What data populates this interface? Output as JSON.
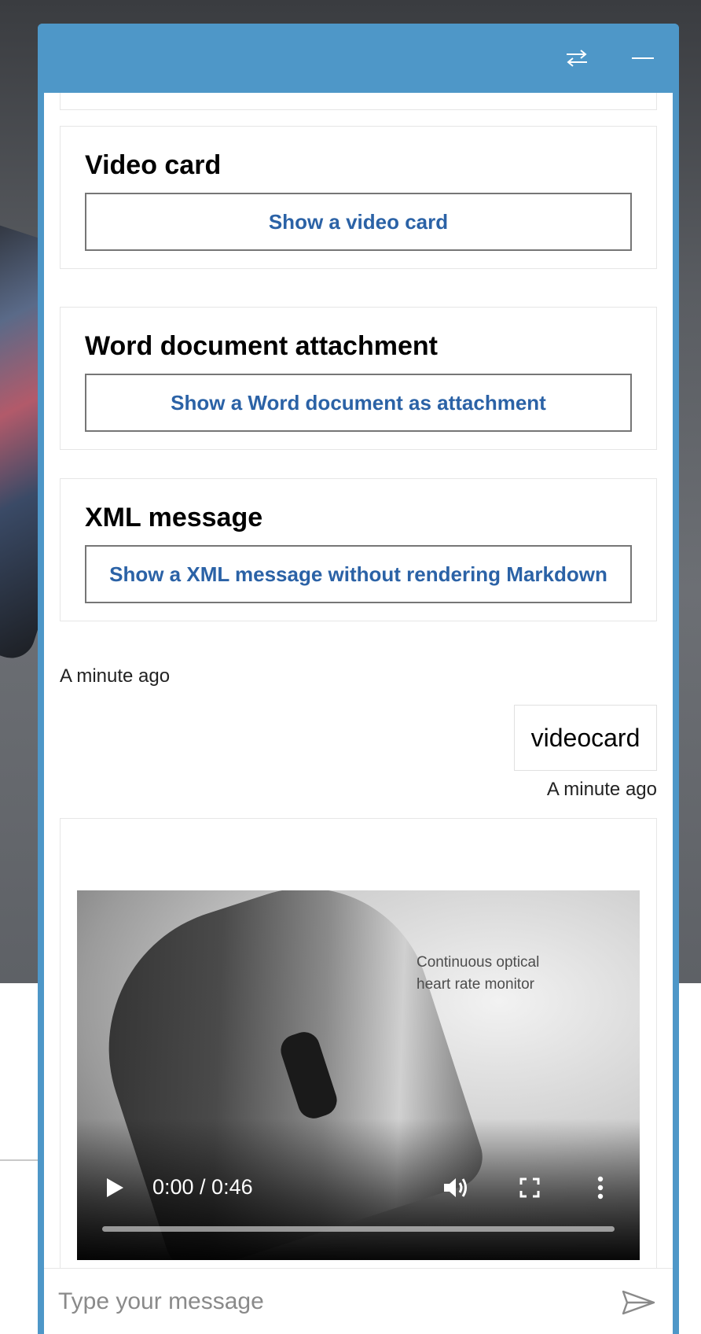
{
  "cards": [
    {
      "title": "Video card",
      "action": "Show a video card"
    },
    {
      "title": "Word document attachment",
      "action": "Show a Word document as attachment"
    },
    {
      "title": "XML message",
      "action": "Show a XML message without rendering Markdown"
    }
  ],
  "bot_timestamp": "A minute ago",
  "user_message": {
    "text": "videocard",
    "timestamp": "A minute ago"
  },
  "video": {
    "caption_line1": "Continuous optical",
    "caption_line2": "heart rate monitor",
    "time": "0:00 / 0:46",
    "progress": 0.0
  },
  "send_box": {
    "placeholder": "Type your message"
  },
  "colors": {
    "header": "#4e97c8",
    "action_text": "#2b62a6"
  },
  "icons": {
    "header_left": "switch-arrows-icon",
    "header_right": "minimize-icon",
    "send": "send-icon",
    "play": "play-icon",
    "volume": "volume-icon",
    "fullscreen": "fullscreen-icon",
    "more": "more-vertical-icon"
  }
}
